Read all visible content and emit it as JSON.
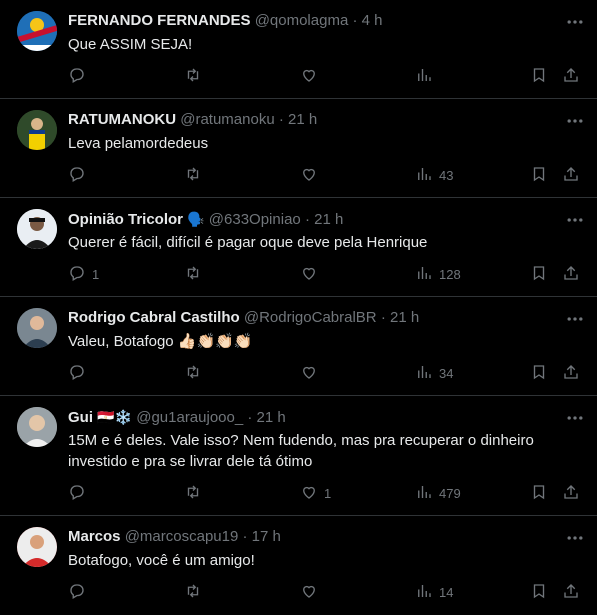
{
  "tweets": [
    {
      "name": "FERNANDO FERNANDES",
      "handle": "@qomolagma",
      "sep": "·",
      "time": "4 h",
      "text": "Que ASSIM SEJA!",
      "reply_count": "",
      "retweet_count": "",
      "like_count": "",
      "view_count": "",
      "avatar_color": "#1f6fb7"
    },
    {
      "name": "RATUMANOKU",
      "handle": "@ratumanoku",
      "sep": "·",
      "time": "21 h",
      "text": "Leva pelamordedeus",
      "reply_count": "",
      "retweet_count": "",
      "like_count": "",
      "view_count": "43",
      "avatar_color": "#3c4f2f"
    },
    {
      "name": "Opinião Tricolor",
      "name_emoji": "🗣️",
      "handle": "@633Opiniao",
      "sep": "·",
      "time": "21 h",
      "text": "Querer é fácil, difícil é pagar oque deve pela Henrique",
      "reply_count": "1",
      "retweet_count": "",
      "like_count": "",
      "view_count": "128",
      "avatar_color": "#dfe6ee"
    },
    {
      "name": "Rodrigo Cabral Castilho",
      "handle": "@RodrigoCabralBR",
      "sep": "·",
      "time": "21 h",
      "text": "Valeu, Botafogo 👍🏻👏🏻👏🏻👏🏻",
      "reply_count": "",
      "retweet_count": "",
      "like_count": "",
      "view_count": "34",
      "avatar_color": "#5f6d78"
    },
    {
      "name": "Gui",
      "name_emoji": "🇪🇬❄️",
      "handle": "@gu1araujooo_",
      "sep": "·",
      "time": "21 h",
      "text": "15M e é deles. Vale isso? Nem fudendo, mas pra recuperar o dinheiro investido e pra se livrar dele tá ótimo",
      "reply_count": "",
      "retweet_count": "",
      "like_count": "1",
      "view_count": "479",
      "avatar_color": "#b8b8b8"
    },
    {
      "name": "Marcos",
      "handle": "@marcoscapu19",
      "sep": "·",
      "time": "17 h",
      "text": "Botafogo, você é um amigo!",
      "reply_count": "",
      "retweet_count": "",
      "like_count": "",
      "view_count": "14",
      "avatar_color": "#d42a2a"
    }
  ],
  "icons": {
    "reply": "reply-icon",
    "retweet": "retweet-icon",
    "like": "like-icon",
    "views": "views-icon",
    "bookmark": "bookmark-icon",
    "share": "share-icon",
    "more": "more-icon"
  }
}
